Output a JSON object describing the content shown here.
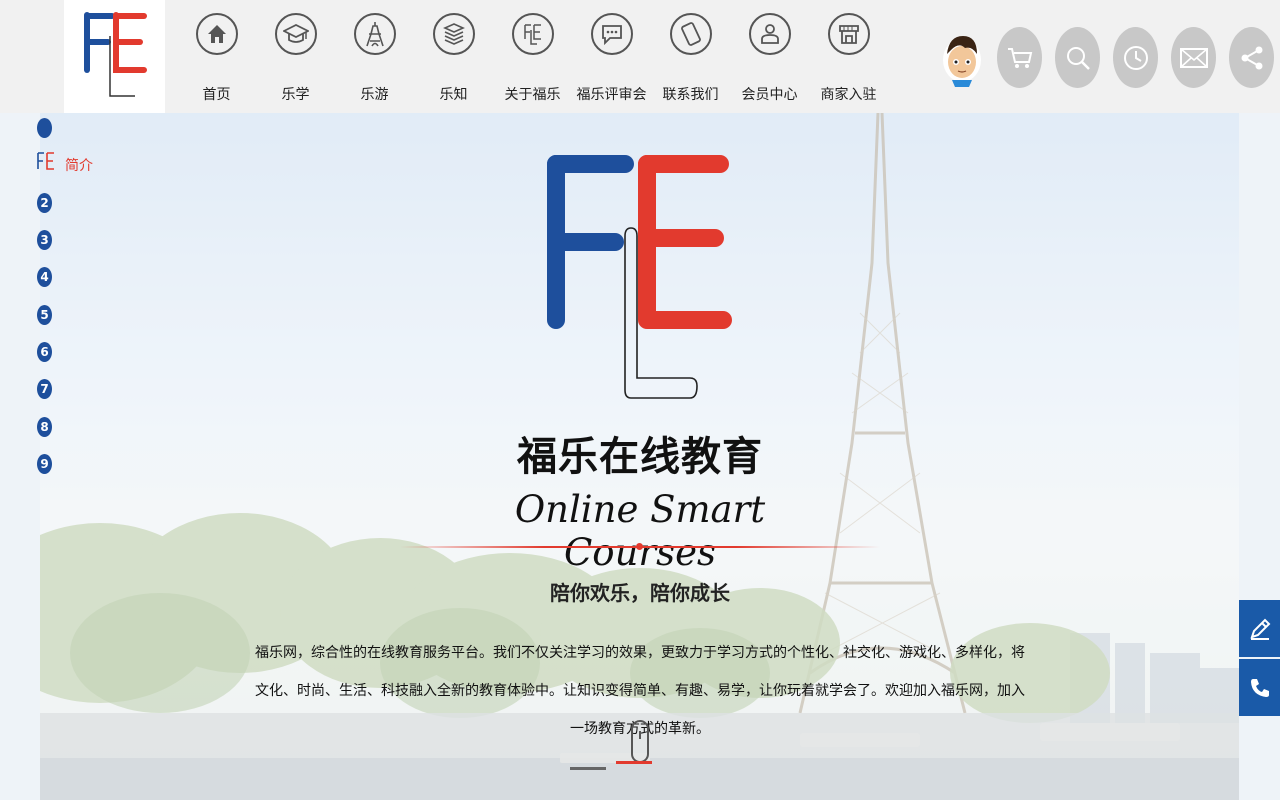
{
  "brand": {
    "blue": "#1e4f9c",
    "red": "#e23a2e",
    "logo_alt": "FLE"
  },
  "nav": {
    "items": [
      {
        "label": "首页",
        "icon": "home-icon"
      },
      {
        "label": "乐学",
        "icon": "graduation-cap-icon"
      },
      {
        "label": "乐游",
        "icon": "eiffel-tower-icon"
      },
      {
        "label": "乐知",
        "icon": "book-stack-icon"
      },
      {
        "label": "关于福乐",
        "icon": "fle-logo-icon"
      },
      {
        "label": "福乐评审会",
        "icon": "chat-bubble-icon"
      },
      {
        "label": "联系我们",
        "icon": "phone-icon"
      },
      {
        "label": "会员中心",
        "icon": "user-icon"
      },
      {
        "label": "商家入驻",
        "icon": "shop-icon"
      }
    ]
  },
  "toolbar": {
    "items": [
      "cart-icon",
      "search-icon",
      "clock-icon",
      "mail-icon",
      "share-icon"
    ]
  },
  "side_nav": {
    "active_label": "简介",
    "numbers": [
      "2",
      "3",
      "4",
      "5",
      "6",
      "7",
      "8",
      "9"
    ]
  },
  "hero": {
    "title_cn": "福乐在线教育",
    "title_en": "Online Smart Courses",
    "tagline": "陪你欢乐，陪你成长",
    "description": "福乐网，综合性的在线教育服务平台。我们不仅关注学习的效果，更致力于学习方式的个性化、社交化、游戏化、多样化，将文化、时尚、生活、科技融入全新的教育体验中。让知识变得简单、有趣、易学，让你玩着就学会了。欢迎加入福乐网，加入一场教育方式的革新。"
  },
  "float_buttons": [
    "edit-icon",
    "phone-icon"
  ]
}
